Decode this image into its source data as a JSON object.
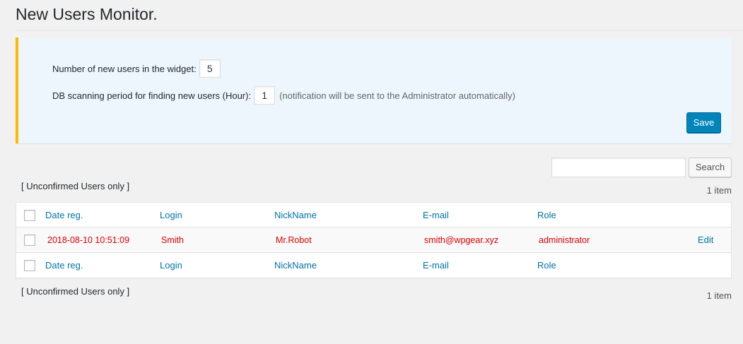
{
  "page": {
    "title": "New Users Monitor."
  },
  "settings": {
    "widget_count_label": "Number of new users in the widget:",
    "widget_count_value": "5",
    "scan_period_label": "DB scanning period for finding new users (Hour):",
    "scan_period_value": "1",
    "scan_period_hint": "(notification will be sent to the Administrator automatically)",
    "save_label": "Save"
  },
  "search": {
    "value": "",
    "button_label": "Search"
  },
  "filter": {
    "label": "[ Unconfirmed Users only ]"
  },
  "pagination": {
    "count_label": "1 item"
  },
  "table": {
    "columns": [
      "Date reg.",
      "Login",
      "NickName",
      "E-mail",
      "Role"
    ],
    "rows": [
      {
        "date_reg": "2018-08-10 10:51:09",
        "login": "Smith",
        "nickname": "Mr.Robot",
        "email": "smith@wpgear.xyz",
        "role": "administrator",
        "action": "Edit"
      }
    ]
  },
  "colors": {
    "accent": "#0073aa",
    "primary_button": "#0085ba",
    "notice_border": "#ffb900",
    "notice_bg": "#eef6fd",
    "unconfirmed_text": "#dd0000"
  }
}
